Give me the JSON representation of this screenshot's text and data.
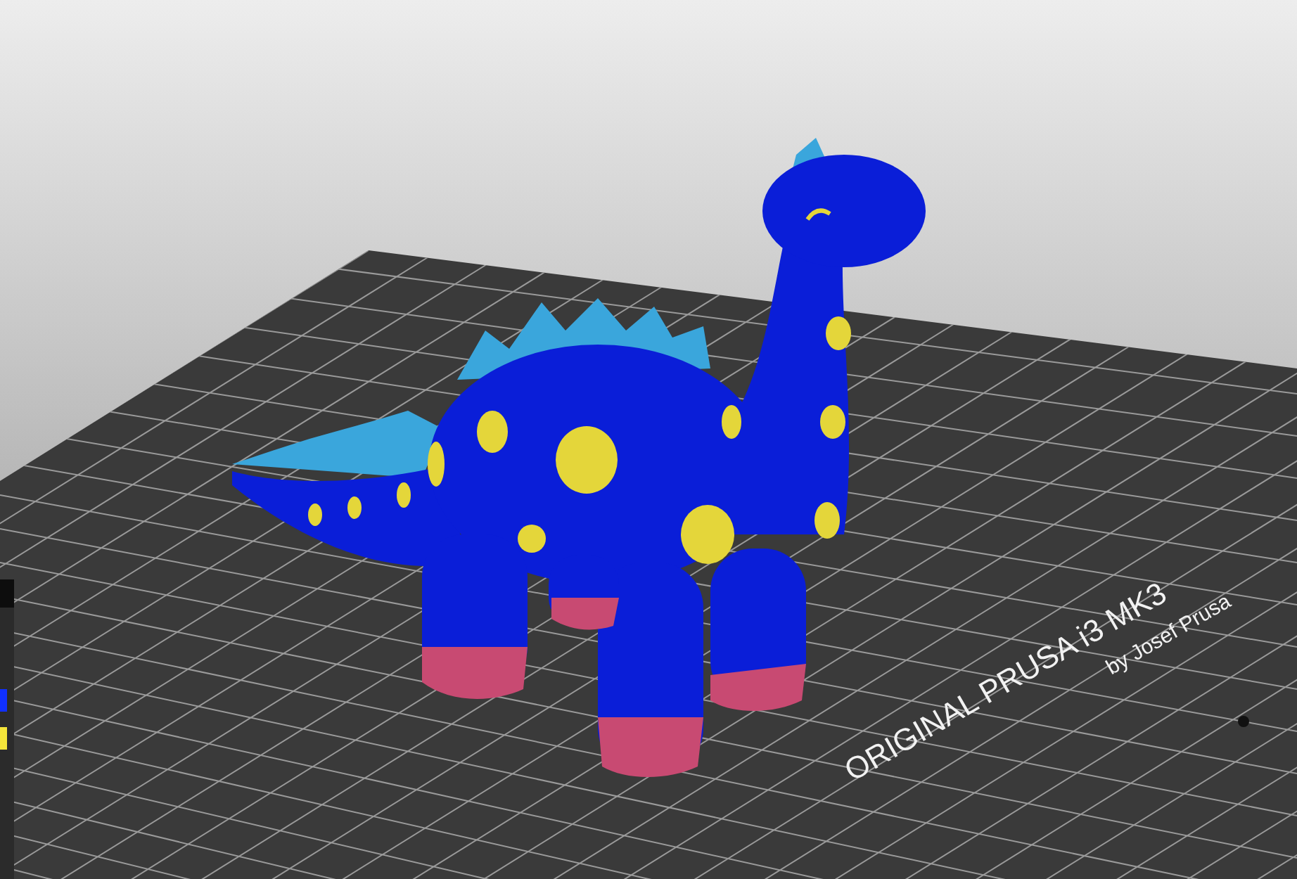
{
  "bed_label": {
    "title": "ORIGINAL PRUSA i3 MK3",
    "subtitle": "by Josef Prusa"
  },
  "extruder_swatches": [
    {
      "color": "#1030ff"
    },
    {
      "color": "#f4e53a"
    }
  ]
}
